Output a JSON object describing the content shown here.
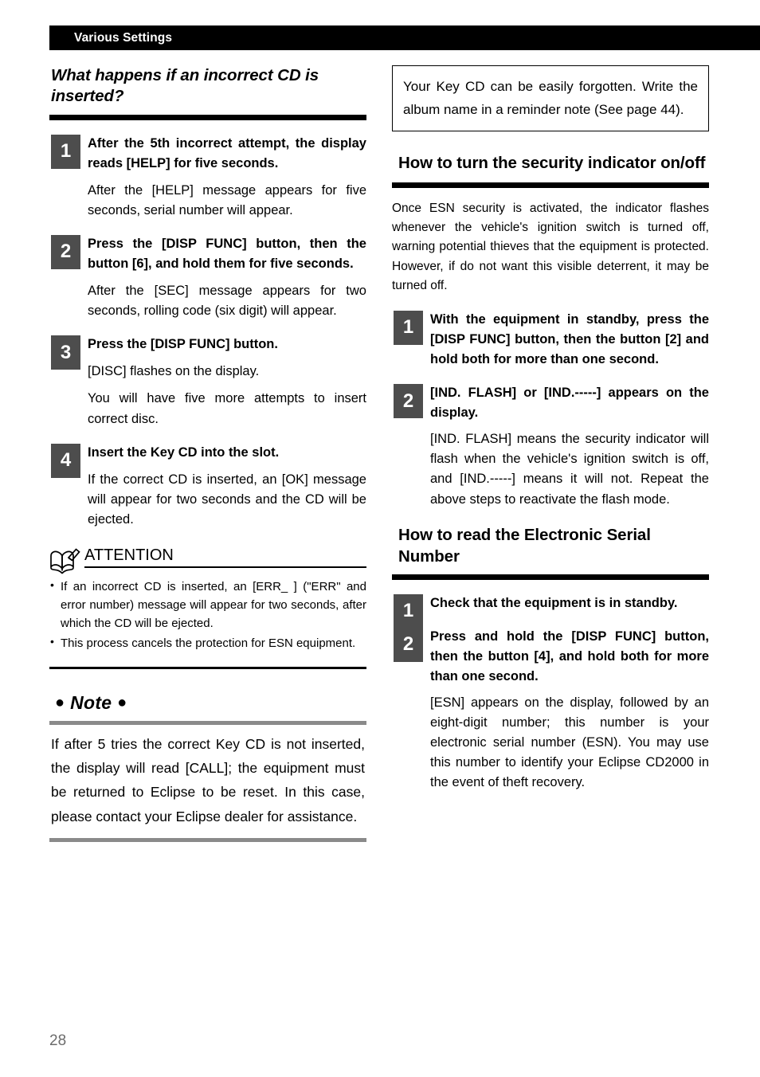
{
  "header": {
    "title": "Various Settings"
  },
  "page_number": "28",
  "colors": {
    "step_box": "#4d4d4d",
    "rule_black": "#000000",
    "rule_gray": "#8a8a8a",
    "page_number": "#6b6b6b"
  },
  "left_column": {
    "heading": "What happens if an incorrect CD is inserted?",
    "steps": [
      {
        "num": "1",
        "title": "After the 5th incorrect attempt, the display reads [HELP] for five seconds.",
        "body": [
          "After the [HELP] message appears for five seconds, serial number will appear."
        ]
      },
      {
        "num": "2",
        "title": "Press the [DISP FUNC] button, then the button [6], and hold them for five seconds.",
        "body": [
          "After the [SEC] message appears for two seconds, rolling code (six digit) will appear."
        ]
      },
      {
        "num": "3",
        "title": "Press the [DISP FUNC] button.",
        "body": [
          "[DISC] flashes on the display.",
          "You will have five more attempts to insert correct disc."
        ]
      },
      {
        "num": "4",
        "title": "Insert the Key CD into the slot.",
        "body": [
          "If the correct CD is inserted, an [OK] message will appear for two seconds and the CD will be ejected."
        ]
      }
    ],
    "attention": {
      "icon": "book-pencil-icon",
      "label": "ATTENTION",
      "items": [
        "If an incorrect CD is inserted, an [ERR_ ] (\"ERR\" and error number) message will appear for two seconds, after which the CD will be ejected.",
        "This process cancels the protection for ESN equipment."
      ]
    },
    "note": {
      "title": "Note",
      "bullet_left": "●",
      "bullet_right": "●",
      "body": "If after 5 tries the correct Key CD is not inserted, the display will read [CALL]; the equipment must be returned to Eclipse to be reset. In this case, please contact your Eclipse dealer for assistance."
    }
  },
  "right_column": {
    "callout": "Your Key CD can be easily forgotten. Write the album name in a reminder note (See page 44).",
    "section_1": {
      "heading": "How to turn the security indicator on/off",
      "intro": "Once ESN security is activated, the indicator flashes whenever the vehicle's ignition switch is turned off, warning potential thieves that the equipment is protected. However, if do not want this visible deterrent, it may be turned off.",
      "steps": [
        {
          "num": "1",
          "title": "With the equipment in standby, press the [DISP FUNC] button, then the button [2] and hold both for more than one second.",
          "body": []
        },
        {
          "num": "2",
          "title": "[IND. FLASH] or [IND.-----] appears on the display.",
          "body": [
            "[IND. FLASH] means the security indicator will flash when the vehicle's ignition switch is off, and [IND.-----] means it will not. Repeat the above steps to reactivate the flash mode."
          ]
        }
      ]
    },
    "section_2": {
      "heading": "How to read the Electronic Serial Number",
      "steps": [
        {
          "num": "1",
          "title": "Check that the equipment is in standby.",
          "body": []
        },
        {
          "num": "2",
          "title": "Press and hold the [DISP FUNC] button, then the button [4], and hold both for more than one second.",
          "body": [
            "[ESN] appears on the display, followed by an eight-digit number; this number is your electronic serial number (ESN). You may use this number to identify your Eclipse CD2000 in the event of theft recovery."
          ]
        }
      ]
    }
  }
}
